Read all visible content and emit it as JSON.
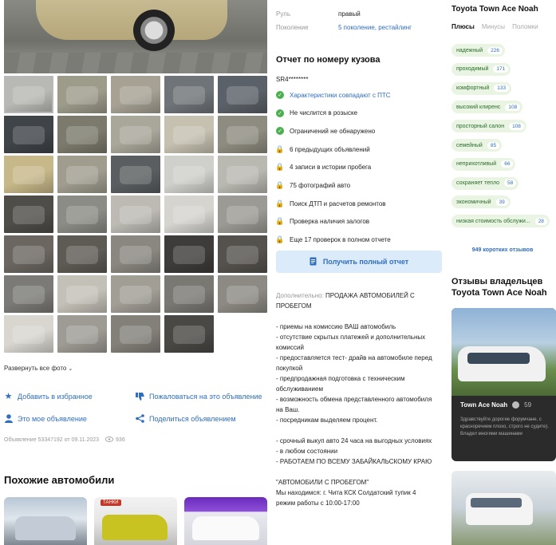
{
  "specs": [
    {
      "key": "Руль",
      "value": "правый",
      "link": false
    },
    {
      "key": "Поколение",
      "value": "5 поколение, рестайлинг",
      "link": true
    }
  ],
  "gallery": {
    "thumb_colors": [
      "#b8b8b4",
      "#9d9b8a",
      "#a6a193",
      "#6f7478",
      "#5b6168",
      "#3f4448",
      "#7c7a6c",
      "#a9a79a",
      "#c5c0b0",
      "#8e8c80",
      "#c7b889",
      "#a09d8f",
      "#5a5e60",
      "#cfcfcb",
      "#b9b8b1",
      "#4f4d48",
      "#8c8c86",
      "#bcbab3",
      "#d5d4cf",
      "#9b9a94",
      "#6b6660",
      "#5e5a54",
      "#8a8780",
      "#3e3c3a",
      "#55524d",
      "#7b7a76",
      "#c3c0b7",
      "#a19e96",
      "#7a7873",
      "#8d8a83",
      "#d8d6cf",
      "#9e9b94",
      "#838079",
      "#4a4845"
    ],
    "expand_label": "Развернуть все фото"
  },
  "actions": {
    "favorite": "Добавить в избранное",
    "complain": "Пожаловаться на это объявление",
    "my_ad": "Это мое объявление",
    "share": "Поделиться объявлением"
  },
  "meta": {
    "ad_info": "Объявление 53347192 от 09.11.2023",
    "views": "936"
  },
  "similar": {
    "title": "Похожие автомобили",
    "badge": "ТАНКИ"
  },
  "report": {
    "title": "Отчет по номеру кузова",
    "code": "SR4********",
    "checks": [
      {
        "text": "Характеристики совпадают с ПТС",
        "status": "ok",
        "link": true
      },
      {
        "text": "Не числится в розыске",
        "status": "ok",
        "link": false
      },
      {
        "text": "Ограничений не обнаружено",
        "status": "ok",
        "link": false
      },
      {
        "text": "6 предыдущих объявлений",
        "status": "locked",
        "link": false
      },
      {
        "text": "4 записи в истории пробега",
        "status": "locked",
        "link": false
      },
      {
        "text": "75 фотографий авто",
        "status": "locked",
        "link": false
      },
      {
        "text": "Поиск ДТП и расчетов ремонтов",
        "status": "locked",
        "link": false
      },
      {
        "text": "Проверка наличия залогов",
        "status": "locked",
        "link": false
      },
      {
        "text": "Еще 17 проверок в полном отчете",
        "status": "locked",
        "link": false
      }
    ],
    "button": "Получить полный отчет"
  },
  "description": {
    "label": "Дополнительно:",
    "heading": "ПРОДАЖА АВТОМОБИЛЕЙ С ПРОБЕГОМ",
    "lines": [
      "- приемы на комиссию ВАШ автомобиль",
      "- отсутствие скрытых платежей и дополнительных комиссий",
      "- предоставляется тест- драйв на автомобиле перед покупкой",
      "- предпродажная подготовка с техническим обслуживанием",
      "- возможность обмена представленного автомобиля на Ваш.",
      "- посредникам выделяем процент.",
      "",
      "- срочный выкуп авто 24 часа на выгодных условиях",
      "- в любом состоянии",
      "- РАБОТАЕМ ПО ВСЕМУ ЗАБАЙКАЛЬСКОМУ КРАЮ",
      "",
      "\"АВТОМОБИЛИ С ПРОБЕГОМ\"",
      "Мы находимся: г. Чита КСК Солдатский тупик 4",
      "режим работы с 10:00-17:00"
    ]
  },
  "reviews": {
    "title": "Toyota Town Ace Noah",
    "tabs": [
      {
        "label": "Плюсы",
        "active": true
      },
      {
        "label": "Минусы",
        "active": false
      },
      {
        "label": "Поломки",
        "active": false
      }
    ],
    "tags": [
      {
        "label": "надежный",
        "count": "226"
      },
      {
        "label": "проходимый",
        "count": "171"
      },
      {
        "label": "комфортный",
        "count": "133"
      },
      {
        "label": "высокий клиренс",
        "count": "108"
      },
      {
        "label": "просторный салон",
        "count": "108"
      },
      {
        "label": "семейный",
        "count": "85"
      },
      {
        "label": "неприхотливый",
        "count": "66"
      },
      {
        "label": "сохраняет тепло",
        "count": "58"
      },
      {
        "label": "экономичный",
        "count": "39"
      },
      {
        "label": "низкая стоимость обслужи...",
        "count": "28"
      }
    ],
    "short_reviews": "949 коротких отзывов",
    "owners_title": "Отзывы владельцев Toyota Town Ace Noah",
    "card": {
      "name": "Town Ace Noah",
      "score": "59",
      "snippet": "Здравствуйте дорогие форумчане, с красноречием плохо, строго не судите). Владел многими машинами"
    }
  },
  "colors": {
    "link": "#2f6ec0",
    "ok": "#4caf50",
    "tag_bg": "#e9f5e2",
    "button_bg": "#dcebf9"
  }
}
